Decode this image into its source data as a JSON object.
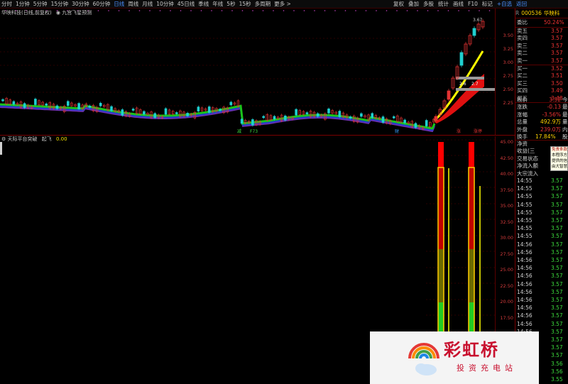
{
  "toolbar": {
    "periods": [
      "分时",
      "1分钟",
      "5分钟",
      "15分钟",
      "30分钟",
      "60分钟",
      "日线",
      "周线",
      "月线",
      "10分钟",
      "45日线",
      "季线",
      "年线",
      "5秒",
      "15秒",
      "多周期",
      "更多 >"
    ],
    "active_period": "日线",
    "right_tools": [
      "复权",
      "叠加",
      "多股",
      "统计",
      "画线",
      "F10",
      "标记",
      "+自选",
      "返回"
    ]
  },
  "chart": {
    "title": "华映科技(日线,前复权)",
    "indicator": "九宫飞星预测",
    "y_labels": [
      "3.50",
      "3.25",
      "3.00",
      "2.75",
      "2.50",
      "2.25"
    ],
    "high_marker": "3.67",
    "bottom_marks": [
      "减",
      "F73",
      "财",
      "涨",
      "涨停"
    ],
    "box_labels": [
      "2.6",
      "2.7"
    ]
  },
  "lower": {
    "title": "天际平台突破",
    "sub": "起飞",
    "value": "0.00",
    "y_labels": [
      "45.00",
      "42.50",
      "40.00",
      "37.50",
      "35.00",
      "32.50",
      "30.00",
      "27.50",
      "25.00",
      "22.50",
      "20.00",
      "17.50",
      "15.00",
      "12.50",
      "10.00"
    ]
  },
  "quote": {
    "code": "000536",
    "name": "华映科",
    "r_label": "R",
    "weibi_label": "委比",
    "weibi_value": "50.24%",
    "sells": [
      {
        "label": "卖五",
        "price": "3.57"
      },
      {
        "label": "卖四",
        "price": "3.57"
      },
      {
        "label": "卖三",
        "price": "3.57"
      },
      {
        "label": "卖二",
        "price": "3.57"
      },
      {
        "label": "卖一",
        "price": "3.57"
      }
    ],
    "buys": [
      {
        "label": "买一",
        "price": "3.52"
      },
      {
        "label": "买二",
        "price": "3.51"
      },
      {
        "label": "买三",
        "price": "3.50"
      },
      {
        "label": "买四",
        "price": "3.49"
      },
      {
        "label": "买五",
        "price": "3.48"
      }
    ],
    "stats": [
      {
        "label": "现价",
        "value": "3.52",
        "unit": "今"
      },
      {
        "label": "涨跌",
        "value": "-0.13",
        "unit": "最"
      },
      {
        "label": "涨幅",
        "value": "-3.56%",
        "unit": "最"
      },
      {
        "label": "总量",
        "value": "492.9万",
        "unit": "量"
      },
      {
        "label": "外盘",
        "value": "239.0万",
        "unit": "内"
      }
    ],
    "turnover_label": "换手",
    "turnover_value": "17.84%",
    "turnover_unit": "股",
    "extra_labels": [
      "净资",
      "收益(三",
      "交易状态",
      "净流入额",
      "大宗流入"
    ],
    "tooltip_lines": [
      "免责条款:",
      "本程序方案",
      "提供的信息仅",
      "由大智慧权威"
    ],
    "ticks": [
      {
        "time": "14:55",
        "price": "3.57"
      },
      {
        "time": "14:55",
        "price": "3.57"
      },
      {
        "time": "14:55",
        "price": "3.57"
      },
      {
        "time": "14:55",
        "price": "3.57"
      },
      {
        "time": "14:55",
        "price": "3.57"
      },
      {
        "time": "14:55",
        "price": "3.57"
      },
      {
        "time": "14:55",
        "price": "3.57"
      },
      {
        "time": "14:55",
        "price": "3.57"
      },
      {
        "time": "14:56",
        "price": "3.57"
      },
      {
        "time": "14:56",
        "price": "3.57"
      },
      {
        "time": "14:56",
        "price": "3.57"
      },
      {
        "time": "14:56",
        "price": "3.57"
      },
      {
        "time": "14:56",
        "price": "3.57"
      },
      {
        "time": "14:56",
        "price": "3.57"
      },
      {
        "time": "14:56",
        "price": "3.57"
      },
      {
        "time": "14:56",
        "price": "3.57"
      },
      {
        "time": "14:56",
        "price": "3.57"
      },
      {
        "time": "14:56",
        "price": "3.57"
      },
      {
        "time": "14:56",
        "price": "3.57"
      },
      {
        "time": "14:56",
        "price": "3.57"
      },
      {
        "time": "14:56",
        "price": "3.57"
      },
      {
        "time": "14:56",
        "price": "3.57"
      },
      {
        "time": "14:56",
        "price": "3.57"
      },
      {
        "time": "14:56",
        "price": "3.56"
      },
      {
        "time": "14:56",
        "price": "3.56"
      },
      {
        "time": "14:56",
        "price": "3.55"
      }
    ]
  },
  "watermark": {
    "brand": "彩虹桥",
    "tagline": "投资充电站"
  },
  "colors": {
    "up": "#e33333",
    "down": "#3ddc3d",
    "accent": "#4a90ff",
    "ma_yellow": "#ffff00"
  }
}
